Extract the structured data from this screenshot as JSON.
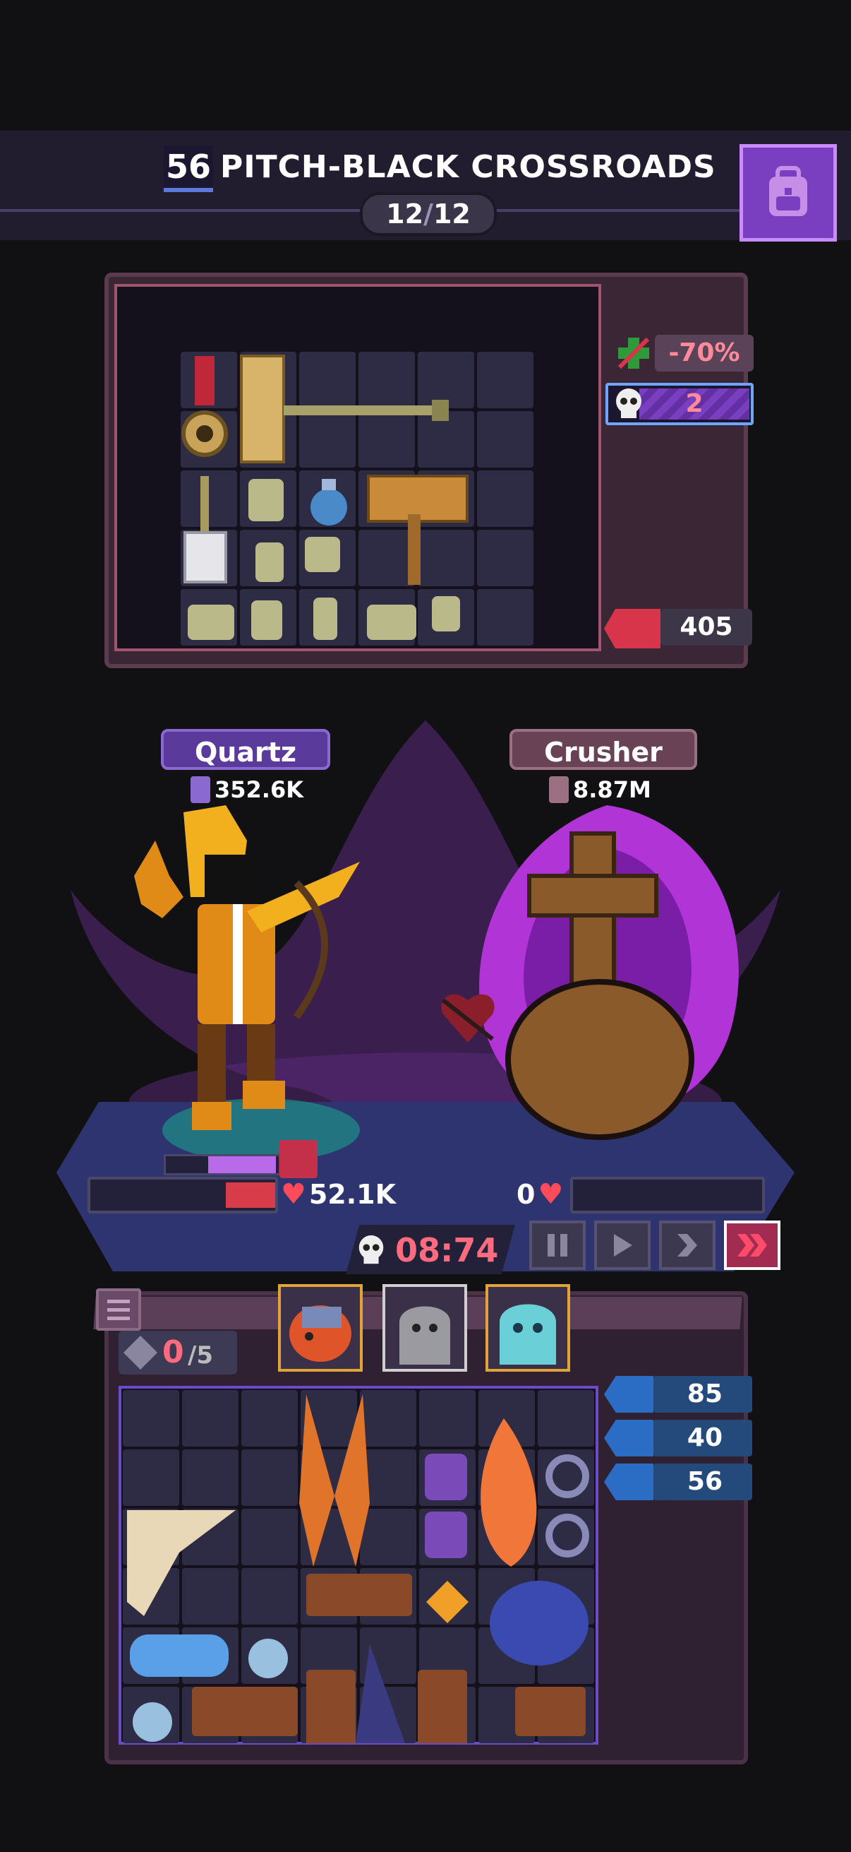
{
  "header": {
    "stage_number": "56",
    "stage_title": "PITCH-BLACK CROSSROADS",
    "wave_current": "12",
    "wave_sep": "/",
    "wave_total": "12"
  },
  "enemy_panel": {
    "damage_modifier": "-70%",
    "skull_count": "2",
    "rage_value": "405"
  },
  "battle": {
    "player": {
      "name": "Quartz",
      "power": "352.6K",
      "hp": "52.1K"
    },
    "enemy": {
      "name": "Crusher",
      "power": "8.87M",
      "hp": "0"
    },
    "timer": "08:74",
    "controls": [
      {
        "name": "pause-button",
        "icon": "pause-icon"
      },
      {
        "name": "play-button",
        "icon": "play-icon"
      },
      {
        "name": "fast-button",
        "icon": "fast-forward-icon"
      },
      {
        "name": "fastest-button",
        "icon": "fastest-icon",
        "active": true
      }
    ]
  },
  "bag": {
    "gems_current": "0",
    "gems_max": "/5",
    "stats": [
      {
        "icon": "ladder-icon",
        "value": "85"
      },
      {
        "icon": "shield-icon",
        "value": "40"
      },
      {
        "icon": "boot-icon",
        "value": "56"
      }
    ],
    "companions": [
      "companion-dragon",
      "companion-ghost-gray",
      "companion-ghost-blue"
    ]
  },
  "colors": {
    "accent_purple": "#7a3fc1",
    "timer_red": "#ff6b7e",
    "stat_blue": "#2b6cc5",
    "hp_red": "#d83b4a"
  }
}
